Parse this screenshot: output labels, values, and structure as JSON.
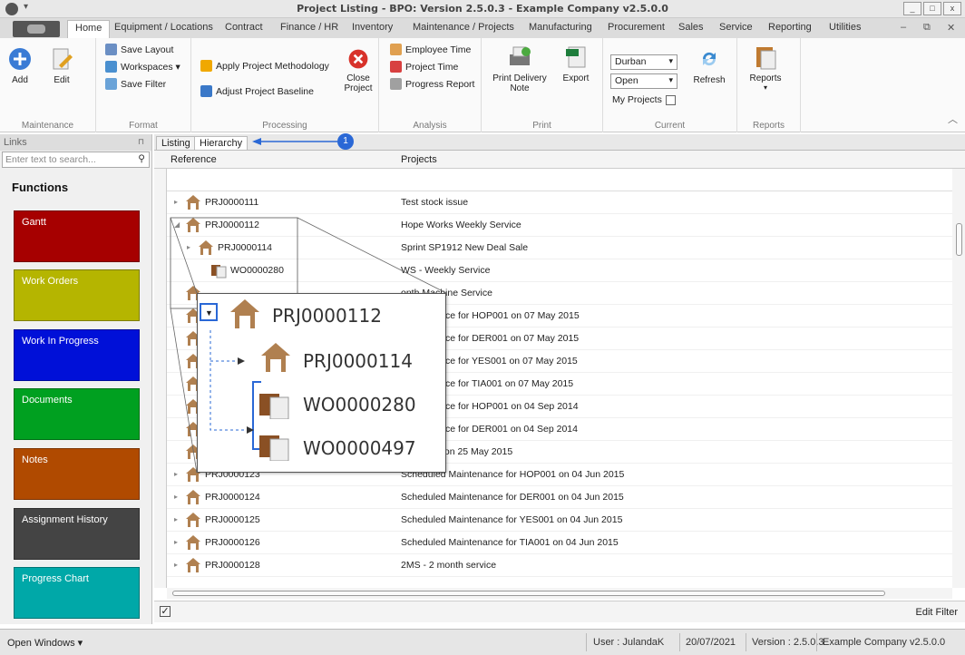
{
  "window": {
    "title": "Project Listing - BPO: Version 2.5.0.3 - Example Company v2.5.0.0",
    "quick_access": "▾"
  },
  "ribbon_tabs": [
    "Home",
    "Equipment / Locations",
    "Contract",
    "Finance / HR",
    "Inventory",
    "Maintenance / Projects",
    "Manufacturing",
    "Procurement",
    "Sales",
    "Service",
    "Reporting",
    "Utilities"
  ],
  "ribbon": {
    "maintenance": {
      "label": "Maintenance",
      "add": "Add",
      "edit": "Edit"
    },
    "format": {
      "label": "Format",
      "save_layout": "Save Layout",
      "workspaces": "Workspaces ▾",
      "save_filter": "Save Filter"
    },
    "processing": {
      "label": "Processing",
      "apply_methodology": "Apply Project Methodology",
      "adjust_baseline": "Adjust Project Baseline",
      "close_project": "Close Project"
    },
    "analysis": {
      "label": "Analysis",
      "employee_time": "Employee Time",
      "project_time": "Project Time",
      "progress_report": "Progress Report"
    },
    "print": {
      "label": "Print",
      "print_delivery": "Print Delivery Note",
      "export": "Export"
    },
    "current": {
      "label": "Current",
      "location": "Durban",
      "status": "Open",
      "my_projects": "My Projects",
      "refresh": "Refresh"
    },
    "reports": {
      "label": "Reports",
      "reports": "Reports"
    }
  },
  "links": {
    "header": "Links",
    "search_placeholder": "Enter text to search...",
    "functions_title": "Functions",
    "tiles": [
      {
        "label": "Gantt",
        "color": "#a60000"
      },
      {
        "label": "Work Orders",
        "color": "#b5b500"
      },
      {
        "label": "Work In Progress",
        "color": "#0010d8"
      },
      {
        "label": "Documents",
        "color": "#00a020"
      },
      {
        "label": "Notes",
        "color": "#b04a00"
      },
      {
        "label": "Assignment History",
        "color": "#444444"
      },
      {
        "label": "Progress Chart",
        "color": "#00a8a8"
      }
    ]
  },
  "list": {
    "tabs": [
      "Listing",
      "Hierarchy"
    ],
    "columns": {
      "reference": "Reference",
      "projects": "Projects"
    },
    "rows": [
      {
        "ref": "PRJ0000111",
        "proj": "Test stock issue"
      },
      {
        "ref": "PRJ0000112",
        "proj": "Hope Works Weekly Service"
      },
      {
        "ref": "PRJ0000114",
        "proj": "Sprint SP1912 New Deal Sale"
      },
      {
        "ref": "WO0000280",
        "proj": "WS - Weekly Service"
      },
      {
        "ref": "",
        "proj": "onth Machine Service"
      },
      {
        "ref": "",
        "proj": "Maintenance for HOP001 on 07 May 2015"
      },
      {
        "ref": "",
        "proj": "Maintenance for DER001 on 07 May 2015"
      },
      {
        "ref": "",
        "proj": "Maintenance for YES001 on 07 May 2015"
      },
      {
        "ref": "",
        "proj": "Maintenance for TIA001 on 07 May 2015"
      },
      {
        "ref": "",
        "proj": "Maintenance for HOP001 on 04 Sep 2014"
      },
      {
        "ref": "",
        "proj": "Maintenance for DER001 on 04 Sep 2014"
      },
      {
        "ref": "",
        "proj": "BOT0001 on 25 May 2015"
      },
      {
        "ref": "PRJ0000123",
        "proj": "Scheduled Maintenance for HOP001 on 04 Jun 2015"
      },
      {
        "ref": "PRJ0000124",
        "proj": "Scheduled Maintenance for DER001 on 04 Jun 2015"
      },
      {
        "ref": "PRJ0000125",
        "proj": "Scheduled Maintenance for YES001 on 04 Jun 2015"
      },
      {
        "ref": "PRJ0000126",
        "proj": "Scheduled Maintenance for TIA001 on 04 Jun 2015"
      },
      {
        "ref": "PRJ0000128",
        "proj": "2MS - 2 month service"
      }
    ],
    "edit_filter": "Edit Filter"
  },
  "zoom": {
    "p1": "PRJ0000112",
    "p2": "PRJ0000114",
    "w1": "WO0000280",
    "w2": "WO0000497"
  },
  "callout": "1",
  "status": {
    "open_windows": "Open Windows ▾",
    "user": "User : JulandaK",
    "date": "20/07/2021",
    "version": "Version : 2.5.0.3",
    "company": "Example Company v2.5.0.0"
  }
}
